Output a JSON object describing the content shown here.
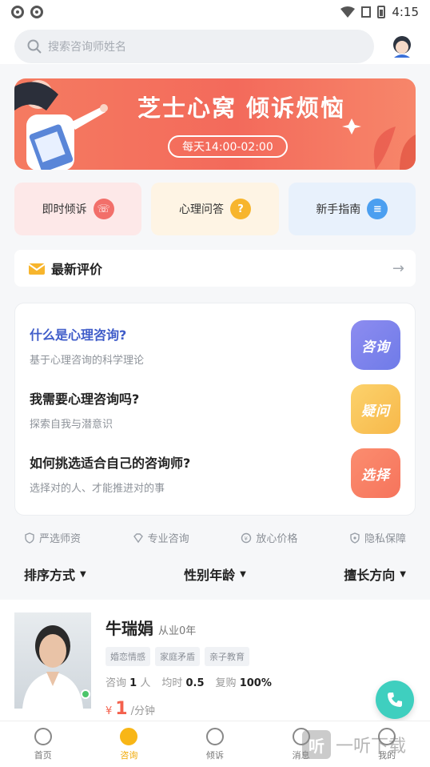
{
  "status_bar": {
    "time": "4:15"
  },
  "search": {
    "placeholder": "搜索咨询师姓名"
  },
  "banner": {
    "title": "芝士心窝 倾诉烦恼",
    "hours": "每天14:00-02:00"
  },
  "quick_actions": [
    {
      "label": "即时倾诉",
      "icon": "phone-bubble-icon",
      "color": "#f26f6a"
    },
    {
      "label": "心理问答",
      "icon": "question-bubble-icon",
      "color": "#f7b52d"
    },
    {
      "label": "新手指南",
      "icon": "guide-bubble-icon",
      "color": "#4b9ff0"
    }
  ],
  "reviews": {
    "label": "最新评价"
  },
  "faq": [
    {
      "question": "什么是心理咨询?",
      "subtitle": "基于心理咨询的科学理论",
      "badge": "咨询",
      "color": "#7a80ea"
    },
    {
      "question": "我需要心理咨询吗?",
      "subtitle": "探索自我与潜意识",
      "badge": "疑问",
      "color": "#f8c454"
    },
    {
      "question": "如何挑选适合自己的咨询师?",
      "subtitle": "选择对的人、才能推进对的事",
      "badge": "选择",
      "color": "#f7795f"
    }
  ],
  "guarantees": [
    "严选师资",
    "专业咨询",
    "放心价格",
    "隐私保障"
  ],
  "filters": [
    "排序方式",
    "性别年龄",
    "擅长方向"
  ],
  "counselor": {
    "name": "牛瑞娟",
    "years": "从业0年",
    "tags": [
      "婚恋情感",
      "家庭矛盾",
      "亲子教育"
    ],
    "stats": {
      "consult_label": "咨询",
      "consult_count": "1",
      "consult_unit": "人",
      "avg_label": "均时",
      "avg_value": "0.5",
      "rebuy_label": "复购",
      "rebuy_value": "100%"
    },
    "price_currency": "¥",
    "price_value": "1",
    "price_unit": "/分钟"
  },
  "tabs": [
    {
      "label": "首页",
      "active": false
    },
    {
      "label": "咨询",
      "active": true
    },
    {
      "label": "倾诉",
      "active": false
    },
    {
      "label": "消息",
      "active": false
    },
    {
      "label": "我的",
      "active": false
    }
  ],
  "watermark": {
    "badge": "听",
    "text": "一听下载"
  },
  "colors": {
    "accent": "#f8b616",
    "price": "#f4614d",
    "fab": "#3fcfbf"
  }
}
